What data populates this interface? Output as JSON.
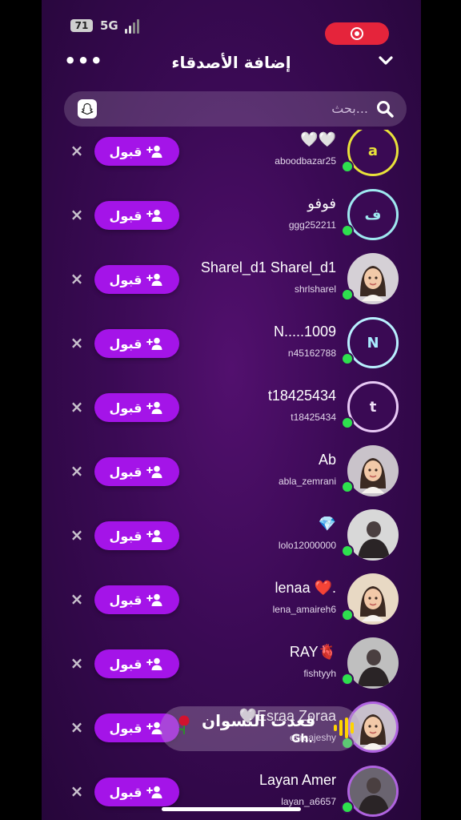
{
  "status": {
    "battery": "71",
    "network": "5G"
  },
  "header": {
    "title": "إضافة الأصدقاء",
    "more": "•••"
  },
  "search": {
    "placeholder": "بحث..."
  },
  "accept_label": "قبول",
  "dismiss_label": "×",
  "rows": [
    {
      "name": "🤍🤍",
      "username": "aboodbazar25",
      "avatar_letter": "a",
      "avatar_ring": "#e9e23a",
      "avatar_text": "#e9e23a",
      "avatar_type": "letter"
    },
    {
      "name": "فوفو",
      "username": "ggg252211",
      "avatar_letter": "ف",
      "avatar_ring": "#9fe9f0",
      "avatar_text": "#9fe9f0",
      "avatar_type": "letter"
    },
    {
      "name": "Sharel_d1 Sharel_d1",
      "username": "shrlsharel",
      "avatar_type": "bitmoji",
      "avatar_bg": "#d5d0d6"
    },
    {
      "name": "N.....1009",
      "username": "n45162788",
      "avatar_letter": "N",
      "avatar_ring": "#b9f0ff",
      "avatar_text": "#a9ecff",
      "avatar_type": "letter"
    },
    {
      "name": "t18425434",
      "username": "t18425434",
      "avatar_letter": "t",
      "avatar_ring": "#e8c9f5",
      "avatar_text": "#efe0f7",
      "avatar_type": "letter"
    },
    {
      "name": "Ab",
      "username": "abla_zemrani",
      "avatar_type": "bitmoji",
      "avatar_bg": "#c9c3ca"
    },
    {
      "name": "💎",
      "username": "lolo12000000",
      "avatar_type": "photo",
      "avatar_bg": "#d8d8d8"
    },
    {
      "name": "lenaa ❤️.",
      "username": "lena_amaireh6",
      "avatar_type": "bitmoji",
      "avatar_bg": "#e8d9c4"
    },
    {
      "name": "RAY🫀",
      "username": "fishtyyh",
      "avatar_type": "photo",
      "avatar_bg": "#bfbfbf"
    },
    {
      "name": "🤍Esraa Zoraa",
      "username": "esraajeshy",
      "avatar_type": "bitmoji",
      "avatar_bg": "#c8c0cc",
      "avatar_ring": "#b063e0"
    },
    {
      "name": "Layan Amer",
      "username": "layan_a6657",
      "avatar_type": "photo",
      "avatar_bg": "#6a6470",
      "avatar_ring": "#b063e0"
    }
  ],
  "music": {
    "song": "قعدت النسوان",
    "artist": "Gh."
  },
  "colors": {
    "accent": "#a414e8",
    "online": "#2ee04e",
    "record": "#e5243b"
  }
}
